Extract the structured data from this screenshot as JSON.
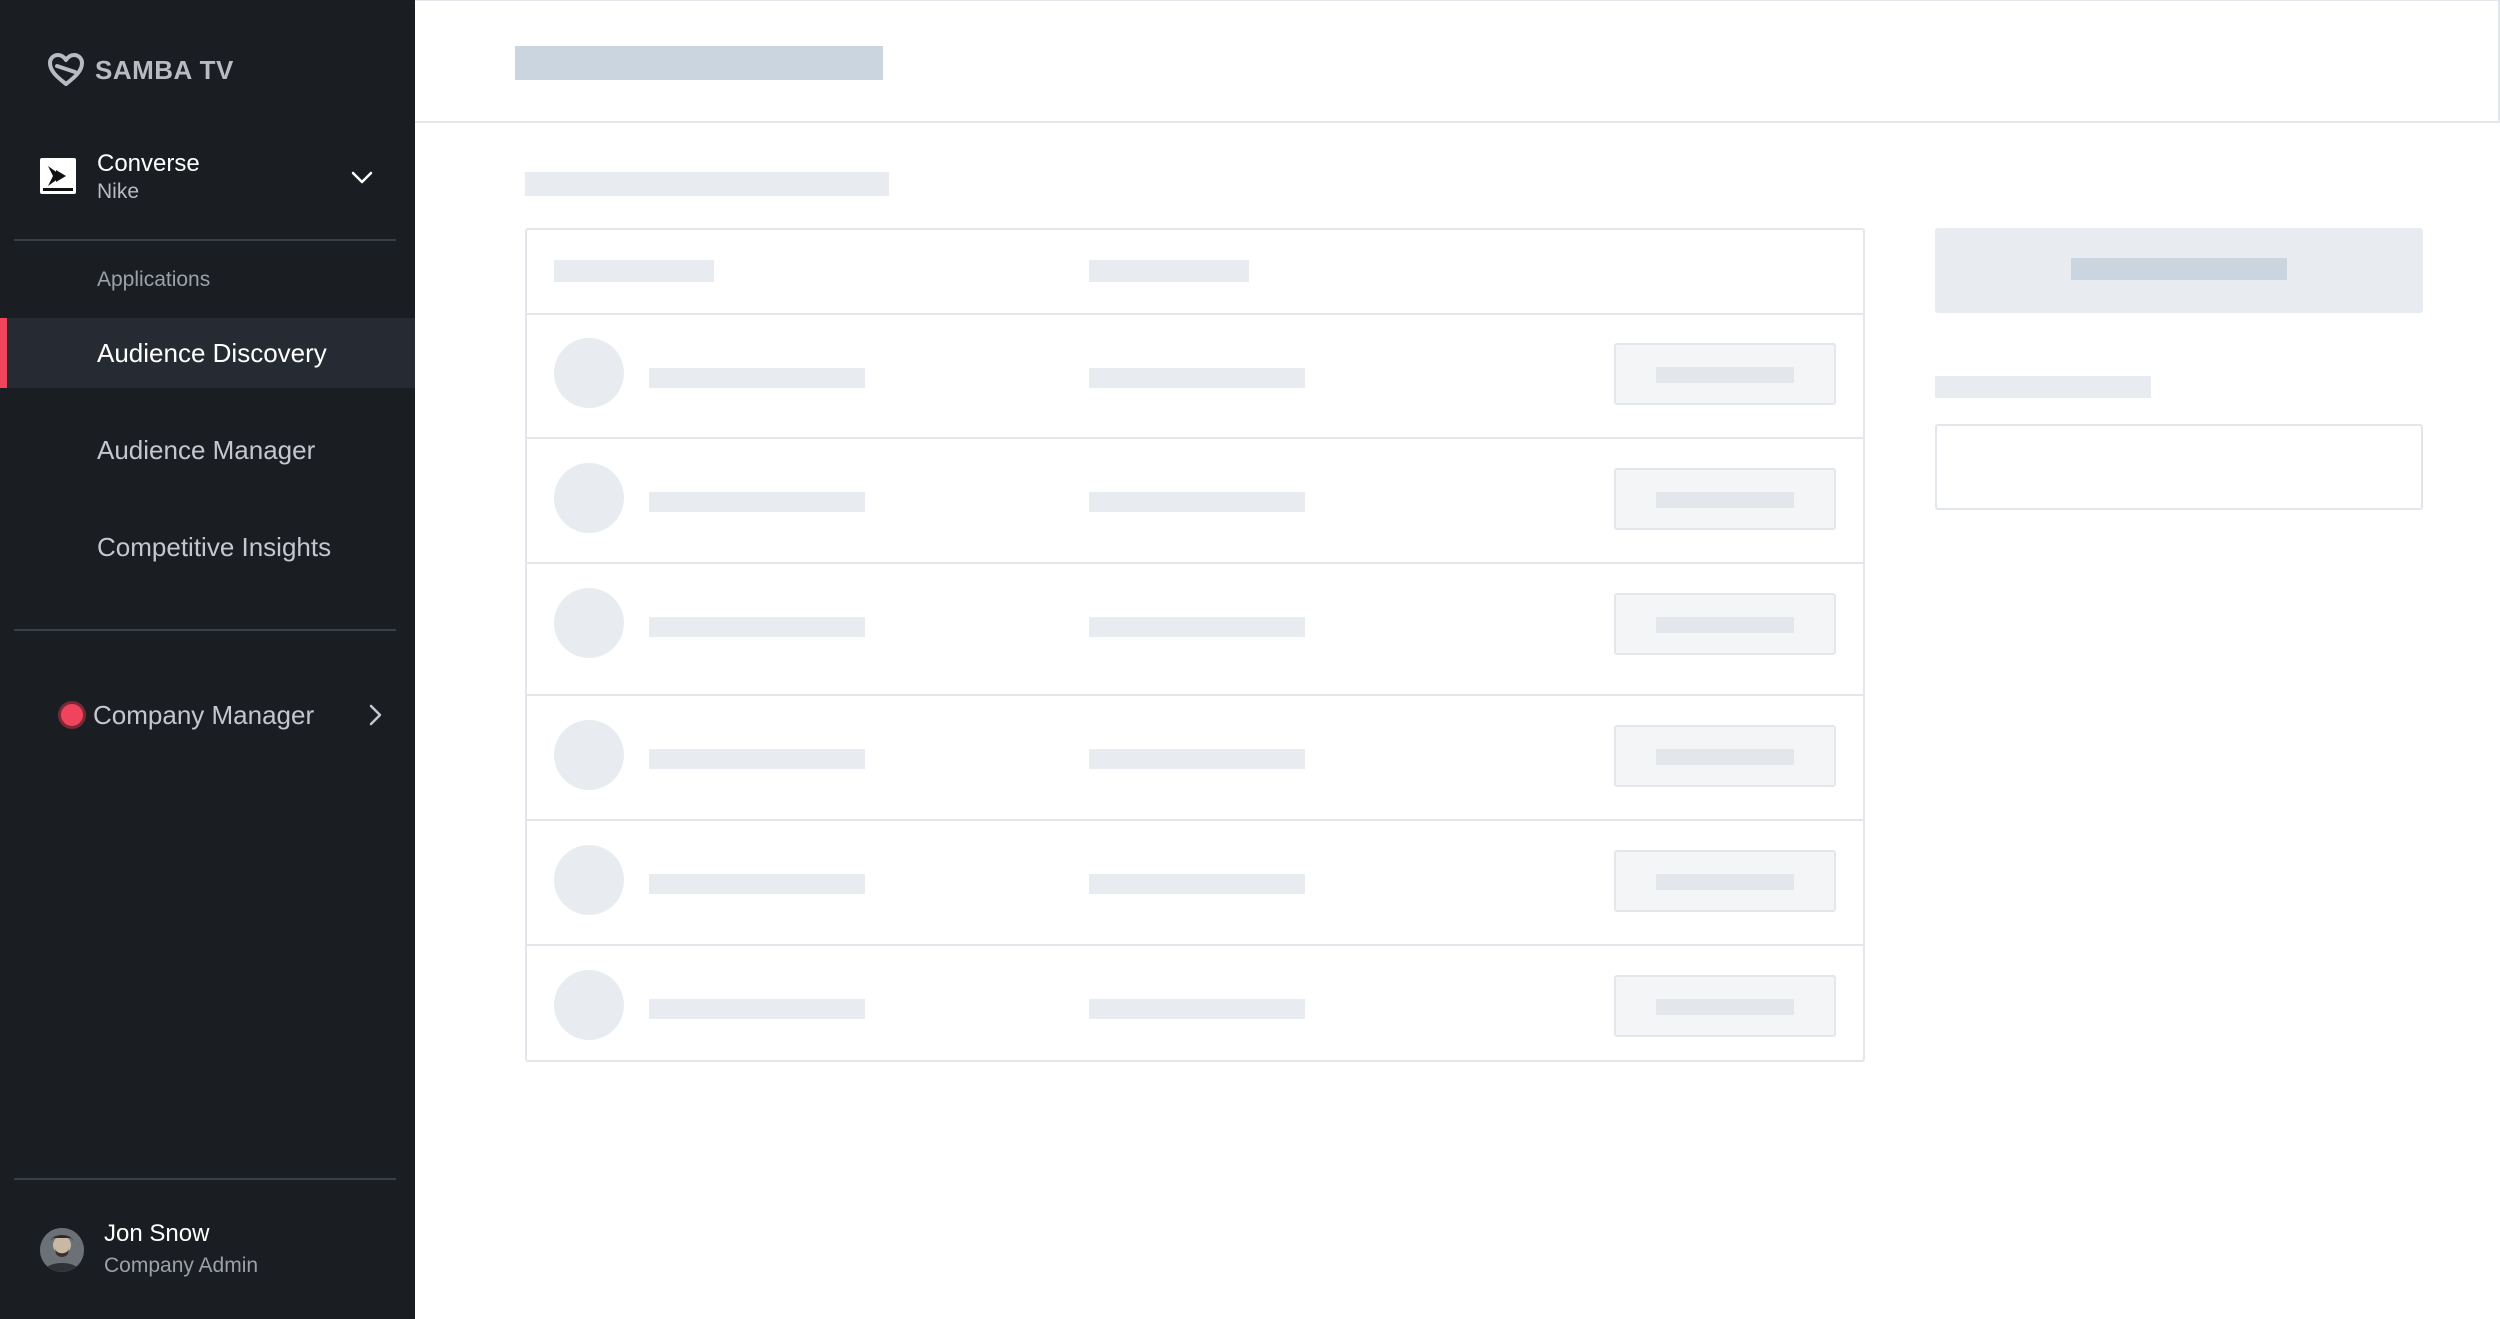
{
  "app": {
    "logo_text": "SAMBA TV"
  },
  "account": {
    "name": "Converse",
    "parent": "Nike"
  },
  "nav": {
    "section_label": "Applications",
    "items": [
      {
        "label": "Audience Discovery",
        "active": true
      },
      {
        "label": "Audience Manager",
        "active": false
      },
      {
        "label": "Competitive Insights",
        "active": false
      }
    ],
    "company_manager": "Company Manager"
  },
  "user": {
    "name": "Jon Snow",
    "role": "Company Admin"
  },
  "colors": {
    "accent": "#f0445c",
    "sidebar_bg": "#1a1e22",
    "skeleton": "#e8ecf0"
  },
  "icons": {
    "logo": "samba-heart-icon",
    "brand": "converse-logo-icon",
    "account_dropdown": "chevron-down-icon",
    "company_manager": "chevron-right-icon"
  },
  "main": {
    "state": "loading",
    "table_rows": 6
  }
}
